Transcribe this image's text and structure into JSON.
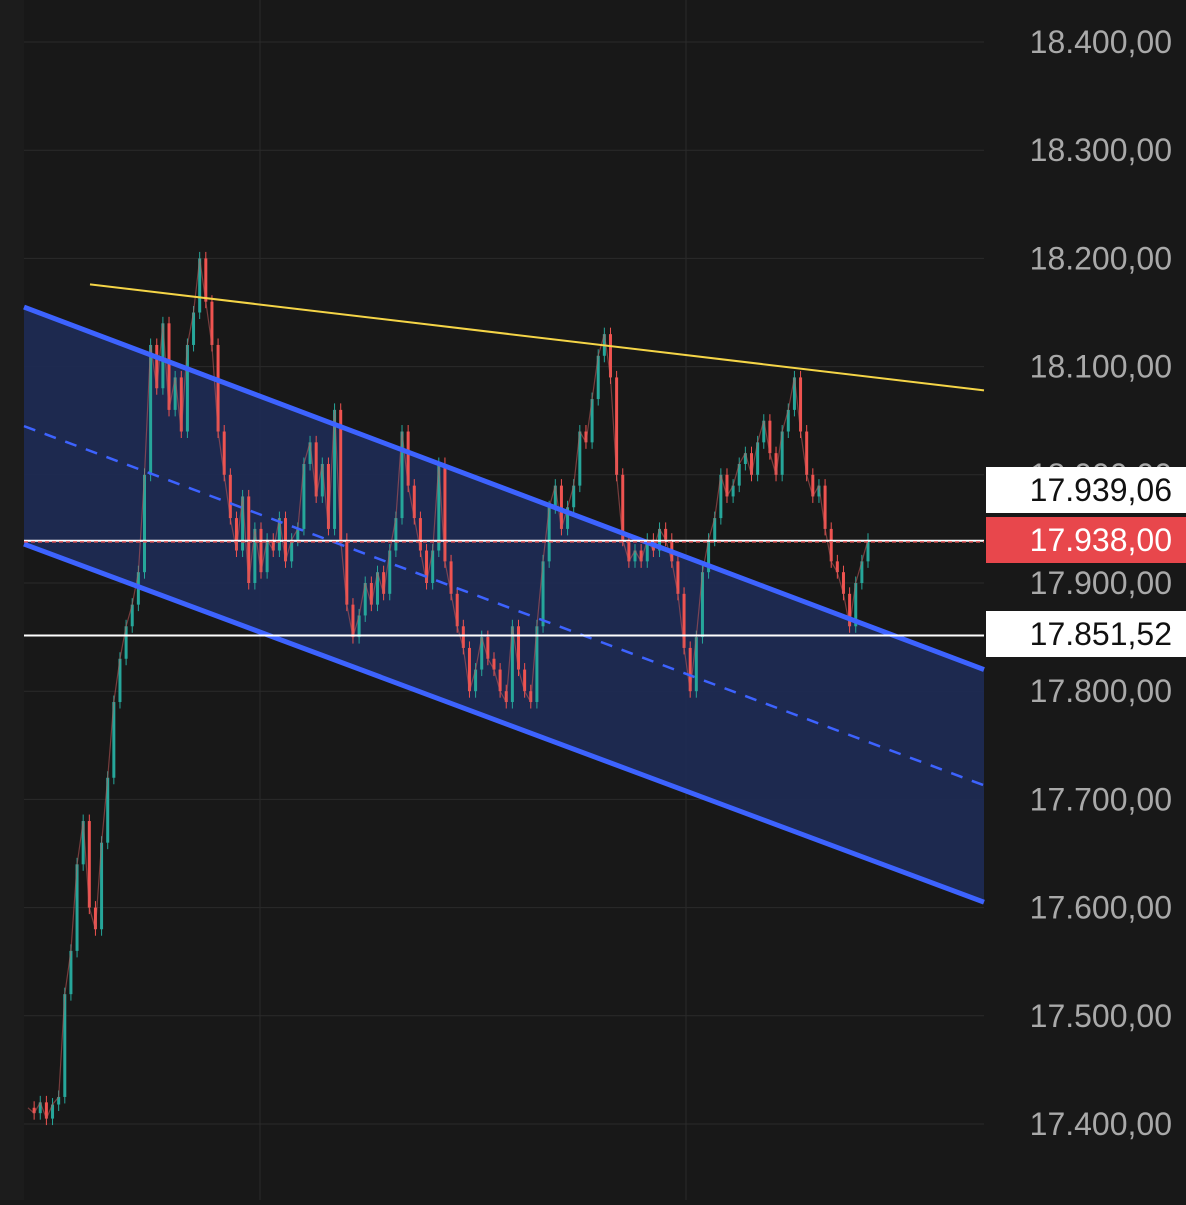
{
  "chart_data": {
    "type": "candlestick",
    "y_axis": {
      "side": "right",
      "ticks": [
        "18.400,00",
        "18.300,00",
        "18.200,00",
        "18.100,00",
        "18.000,00",
        "17.900,00",
        "17.800,00",
        "17.700,00",
        "17.600,00",
        "17.500,00",
        "17.400,00"
      ],
      "tick_values": [
        18400,
        18300,
        18200,
        18100,
        18000,
        17900,
        17800,
        17700,
        17600,
        17500,
        17400
      ],
      "ylim": [
        17330,
        18440
      ]
    },
    "grid": true,
    "price_labels": [
      {
        "text": "17.939,06",
        "value": 17939.06,
        "style": "white"
      },
      {
        "text": "17.938,00",
        "value": 17938.0,
        "style": "red"
      },
      {
        "text": "17.851,52",
        "value": 17851.52,
        "style": "white"
      }
    ],
    "horizontal_lines": [
      {
        "value": 17939.06,
        "color": "#ffffff",
        "dash": "none"
      },
      {
        "value": 17938.0,
        "color": "#e8575a",
        "dash": "dashed"
      },
      {
        "value": 17851.52,
        "color": "#ffffff",
        "dash": "none"
      }
    ],
    "overlays": {
      "resistance_line": {
        "color": "#f5d547",
        "start_value": 18176,
        "end_value": 18078
      },
      "channel": {
        "color": "#3d63ff",
        "fill": "#1e2a52",
        "upper": {
          "start_value": 18155,
          "end_value": 17820
        },
        "middle": {
          "start_value": 18045,
          "end_value": 17713
        },
        "lower": {
          "start_value": 17936,
          "end_value": 17605
        }
      }
    },
    "colors": {
      "up": "#26a69a",
      "down": "#ef5350",
      "background": "#181818"
    },
    "series": [
      {
        "kind": "price_path",
        "values": [
          17415,
          17410,
          17420,
          17405,
          17418,
          17425,
          17520,
          17560,
          17640,
          17680,
          17600,
          17580,
          17660,
          17720,
          17790,
          17830,
          17860,
          17880,
          17910,
          18000,
          18120,
          18080,
          18140,
          18060,
          18090,
          18040,
          18120,
          18150,
          18200,
          18160,
          18120,
          18040,
          18000,
          17960,
          17930,
          17980,
          17900,
          17950,
          17910,
          17940,
          17930,
          17960,
          17920,
          17940,
          17950,
          18010,
          18030,
          17980,
          18010,
          17950,
          18060,
          17940,
          17880,
          17850,
          17870,
          17900,
          17880,
          17910,
          17890,
          17930,
          17960,
          18040,
          17990,
          17960,
          17930,
          17900,
          17930,
          18010,
          17920,
          17890,
          17860,
          17840,
          17800,
          17820,
          17850,
          17830,
          17820,
          17800,
          17790,
          17860,
          17820,
          17800,
          17790,
          17860,
          17920,
          17970,
          17990,
          17950,
          17970,
          17990,
          18040,
          18030,
          18070,
          18110,
          18130,
          18090,
          18000,
          17940,
          17920,
          17930,
          17920,
          17940,
          17930,
          17950,
          17940,
          17920,
          17890,
          17840,
          17800,
          17850,
          17910,
          17940,
          17960,
          18000,
          17980,
          17990,
          18010,
          18020,
          18000,
          18030,
          18050,
          18020,
          18000,
          18040,
          18060,
          18090,
          18040,
          18000,
          17980,
          17990,
          17950,
          17920,
          17910,
          17890,
          17860,
          17900,
          17920,
          17940
        ]
      }
    ]
  }
}
